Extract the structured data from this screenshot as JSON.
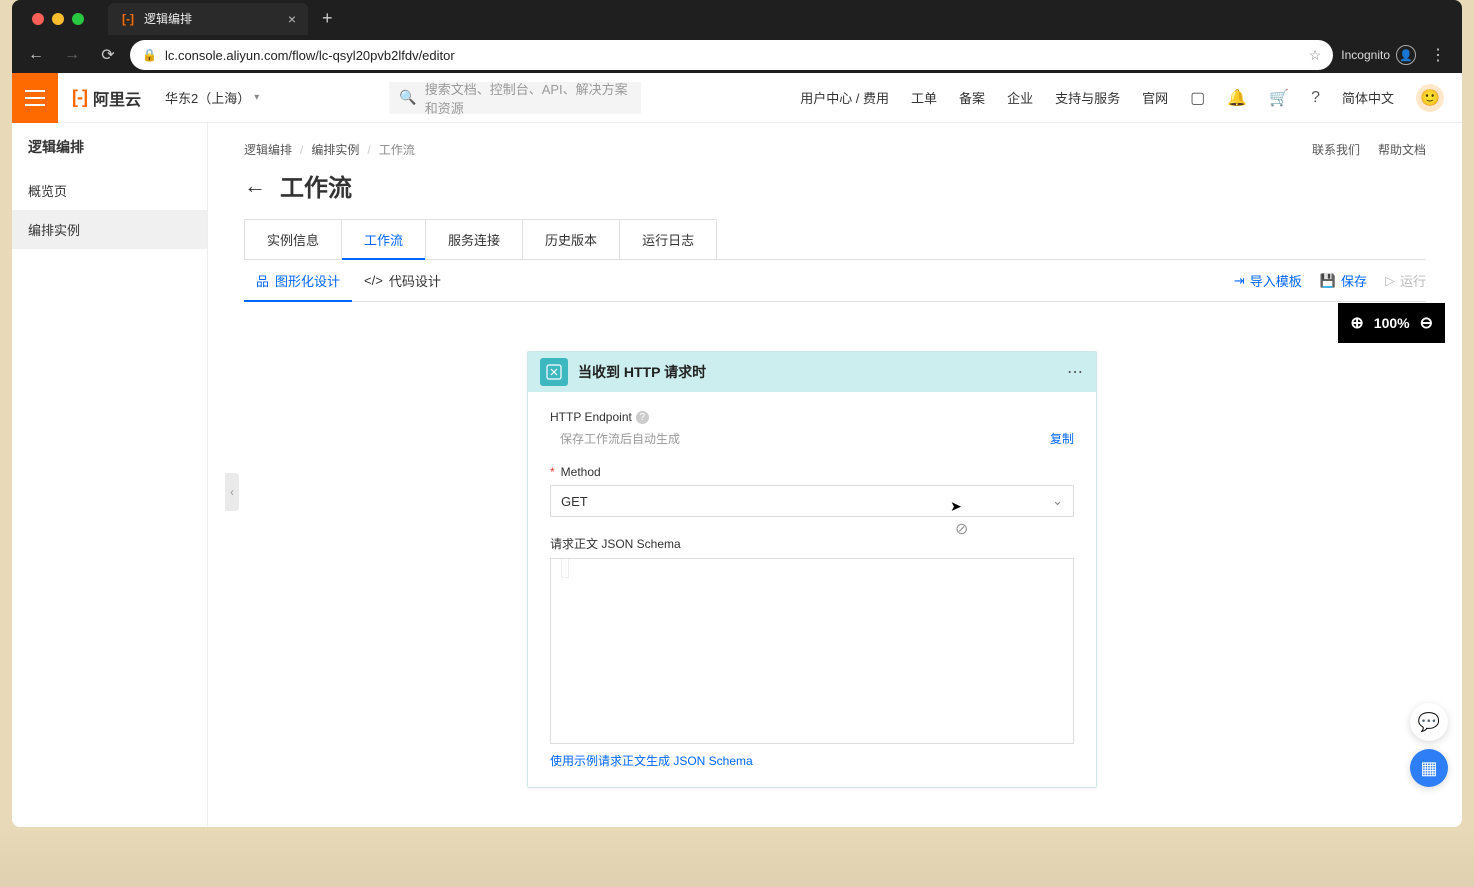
{
  "browser": {
    "tab_title": "逻辑编排",
    "url": "lc.console.aliyun.com/flow/lc-qsyl20pvb2lfdv/editor",
    "incognito_label": "Incognito"
  },
  "header": {
    "logo_text": "阿里云",
    "region": "华东2（上海）",
    "search_placeholder": "搜索文档、控制台、API、解决方案和资源",
    "nav": {
      "user_center": "用户中心 / 费用",
      "tickets": "工单",
      "filing": "备案",
      "enterprise": "企业",
      "support": "支持与服务",
      "official": "官网",
      "lang": "简体中文"
    }
  },
  "sidebar": {
    "title": "逻辑编排",
    "items": [
      {
        "label": "概览页"
      },
      {
        "label": "编排实例"
      }
    ]
  },
  "breadcrumb": {
    "a": "逻辑编排",
    "b": "编排实例",
    "c": "工作流"
  },
  "top_links": {
    "contact": "联系我们",
    "help": "帮助文档"
  },
  "page_title": "工作流",
  "tabs": [
    {
      "label": "实例信息"
    },
    {
      "label": "工作流"
    },
    {
      "label": "服务连接"
    },
    {
      "label": "历史版本"
    },
    {
      "label": "运行日志"
    }
  ],
  "subtabs": {
    "design": "图形化设计",
    "code": "代码设计"
  },
  "actions": {
    "import": "导入模板",
    "save": "保存",
    "run": "运行"
  },
  "zoom": "100%",
  "node": {
    "title": "当收到 HTTP 请求时",
    "endpoint_label": "HTTP Endpoint",
    "endpoint_placeholder": "保存工作流后自动生成",
    "copy": "复制",
    "method_label": "Method",
    "method_value": "GET",
    "schema_label": "请求正文 JSON Schema",
    "gen_link": "使用示例请求正文生成 JSON Schema"
  }
}
